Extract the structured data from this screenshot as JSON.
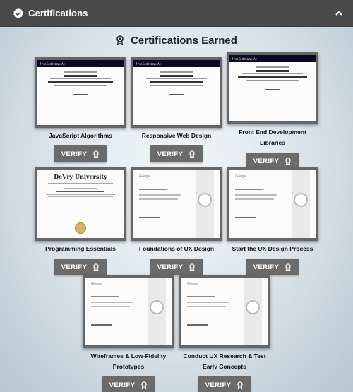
{
  "header": {
    "title": "Certifications",
    "icon": "check-badge-icon",
    "toggle_icon": "chevron-up-icon"
  },
  "panel": {
    "title": "Certifications Earned",
    "title_icon": "award-ribbon-icon"
  },
  "verify_label": "VERIFY",
  "certificates": [
    {
      "name_lines": [
        "JavaScript Algorithms"
      ],
      "issuer": "freeCodeCamp",
      "recipient": "Jeremy Duncan",
      "course": "JavaScript Algorithms and Data Structures"
    },
    {
      "name_lines": [
        "Responsive Web Design"
      ],
      "issuer": "freeCodeCamp",
      "recipient": "Jeremy Duncan",
      "course": "Responsive Web Design"
    },
    {
      "name_lines": [
        "Front End Development",
        "Libraries"
      ],
      "issuer": "freeCodeCamp",
      "recipient": "Jeremy Duncan",
      "course": "Front End Development Libraries"
    },
    {
      "name_lines": [
        "Programming Essentials"
      ],
      "issuer": "DeVry University",
      "recipient": "Jeremy Mark Duncan",
      "course": "Programming Essentials"
    },
    {
      "name_lines": [
        "Foundations of UX Design"
      ],
      "issuer": "Google",
      "recipient": "Jeremy Duncan",
      "course": "Foundations of UX Design"
    },
    {
      "name_lines": [
        "Start the UX Design Process"
      ],
      "issuer": "Google",
      "recipient": "Jeremy Duncan",
      "course": "Start the UX Design Process"
    },
    {
      "name_lines": [
        "Wireframes & Low-Fidelity",
        "Prototypes"
      ],
      "issuer": "Google",
      "recipient": "Jeremy Duncan",
      "course": "Wireframes & Low-Fidelity Prototypes"
    },
    {
      "name_lines": [
        "Conduct UX Research & Test",
        "Early Concepts"
      ],
      "issuer": "Google",
      "recipient": "Jeremy Duncan",
      "course": "Conduct UX Research & Test Early Concepts"
    }
  ],
  "colors": {
    "header_bg": "#4a4a4a",
    "button_bg": "#6b6b6b",
    "fcc_navy": "#0a0a23",
    "devry_gold": "#d8b45a"
  }
}
